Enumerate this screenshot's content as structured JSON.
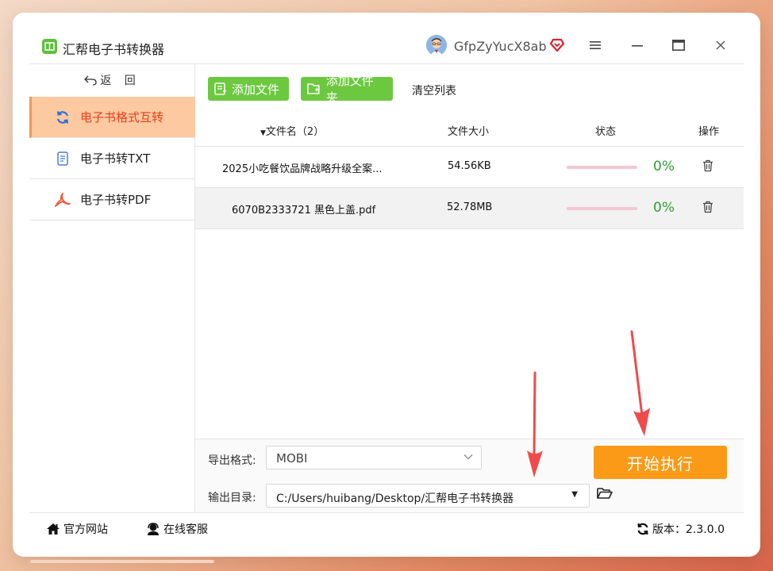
{
  "app": {
    "title": "汇帮电子书转换器",
    "username": "GfpZyYucX8ab"
  },
  "sidebar": {
    "back_label": "返 回",
    "items": [
      {
        "label": "电子书格式互转",
        "icon": "refresh-icon",
        "active": true
      },
      {
        "label": "电子书转TXT",
        "icon": "document-icon",
        "active": false
      },
      {
        "label": "电子书转PDF",
        "icon": "pdf-icon",
        "active": false
      }
    ]
  },
  "toolbar": {
    "add_file": "添加文件",
    "add_folder": "添加文件夹",
    "clear_list": "清空列表"
  },
  "table": {
    "headers": {
      "filename": "文件名（2）",
      "size": "文件大小",
      "status": "状态",
      "action": "操作"
    },
    "rows": [
      {
        "name": "2025小吃餐饮品牌战略升级全案...",
        "size": "54.56KB",
        "progress": "0%"
      },
      {
        "name": "6070B2333721 黑色上盖.pdf",
        "size": "52.78MB",
        "progress": "0%"
      }
    ]
  },
  "options": {
    "format_label": "导出格式:",
    "format_value": "MOBI",
    "dir_label": "输出目录:",
    "dir_value": "C:/Users/huibang/Desktop/汇帮电子书转换器",
    "start_label": "开始执行"
  },
  "footer": {
    "website": "官方网站",
    "support": "在线客服",
    "version": "版本：2.3.0.0"
  },
  "colors": {
    "accent_green": "#6cc93f",
    "start_orange": "#fb9a17",
    "active_bg": "#fcc9a0",
    "active_text": "#e8401c",
    "annotation_arrow": "#ef4b4b"
  }
}
